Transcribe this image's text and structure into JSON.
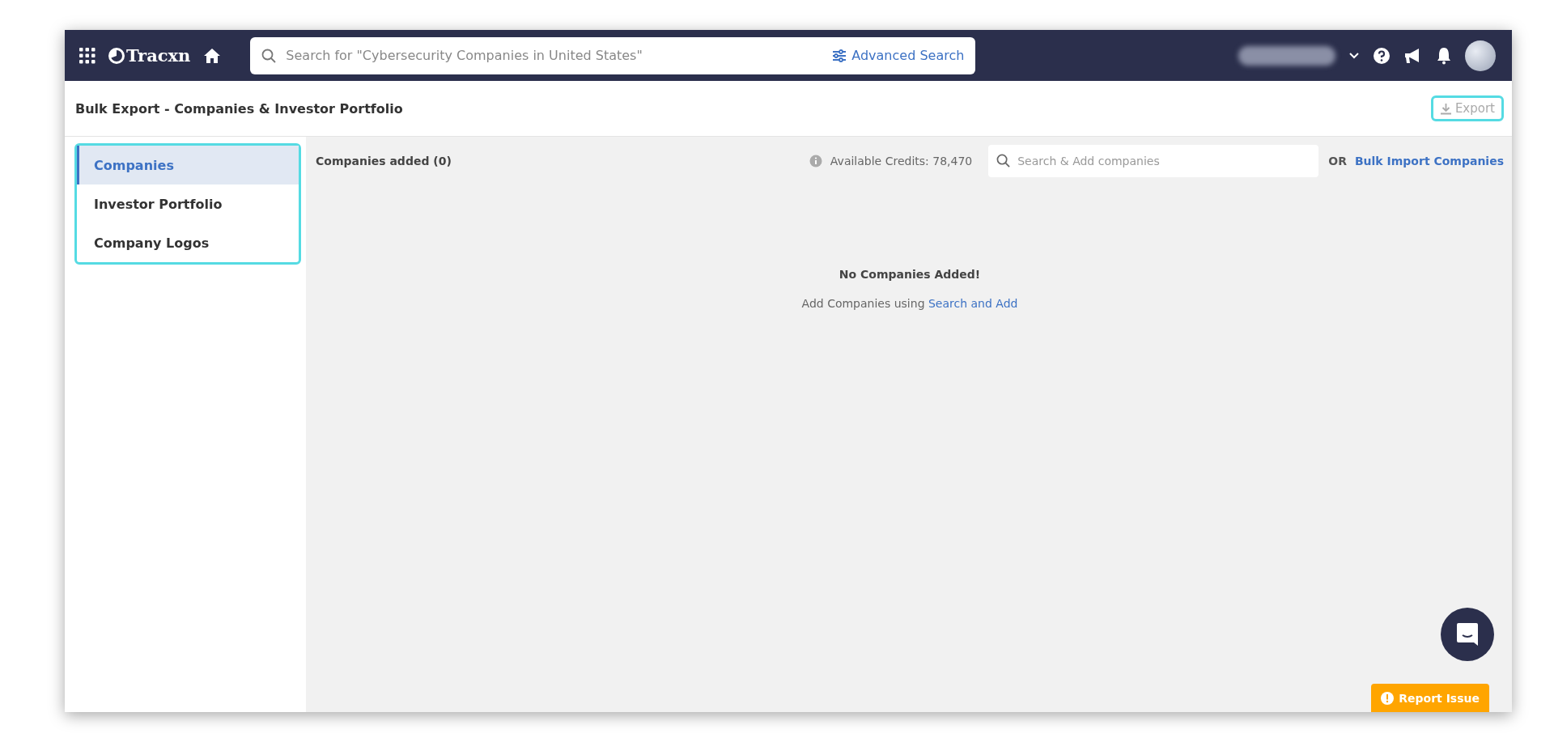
{
  "topbar": {
    "logo": "Tracxn",
    "search": {
      "placeholder": "Search for \"Cybersecurity Companies in United States\""
    },
    "advanced_search": "Advanced Search"
  },
  "header": {
    "title": "Bulk Export - Companies & Investor Portfolio",
    "export": {
      "label": "Export",
      "disabled": true,
      "highlighted": true
    }
  },
  "sidebar": {
    "highlighted": true,
    "items": [
      {
        "label": "Companies",
        "selected": true
      },
      {
        "label": "Investor Portfolio",
        "selected": false
      },
      {
        "label": "Company Logos",
        "selected": false
      }
    ]
  },
  "content": {
    "added": "Companies added (0)",
    "credits": "Available Credits: 78,470",
    "search": {
      "placeholder": "Search & Add companies"
    },
    "or": "OR",
    "bulk_import": "Bulk Import Companies",
    "empty": {
      "title": "No Companies Added!",
      "text": "Add Companies using",
      "link": "Search and Add"
    }
  },
  "report_issue": "Report Issue"
}
